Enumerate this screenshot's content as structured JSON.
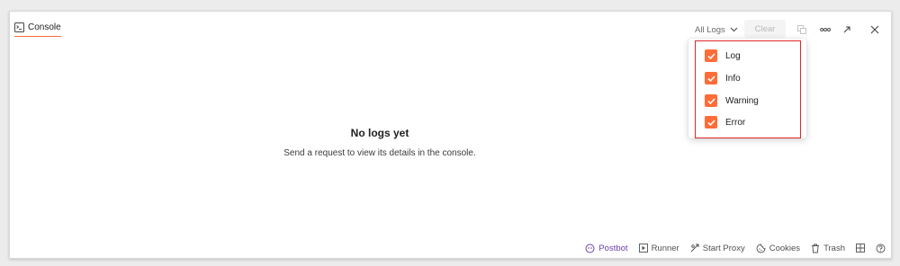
{
  "tab": {
    "label": "Console",
    "icon": "terminal-icon"
  },
  "toolbar": {
    "filter_label": "All Logs",
    "clear_label": "Clear",
    "icons": [
      "copy-icon",
      "more-icon",
      "expand-icon",
      "close-icon"
    ]
  },
  "empty_state": {
    "title": "No logs yet",
    "subtitle": "Send a request to view its details in the console."
  },
  "dropdown": {
    "items": [
      {
        "label": "Log",
        "checked": true
      },
      {
        "label": "Info",
        "checked": true
      },
      {
        "label": "Warning",
        "checked": true
      },
      {
        "label": "Error",
        "checked": true
      }
    ]
  },
  "footer": {
    "postbot": "Postbot",
    "runner": "Runner",
    "proxy": "Start Proxy",
    "cookies": "Cookies",
    "trash": "Trash"
  },
  "colors": {
    "accent": "#ff6c37",
    "highlight_border": "#e0262b",
    "postbot": "#6b3fb0"
  }
}
